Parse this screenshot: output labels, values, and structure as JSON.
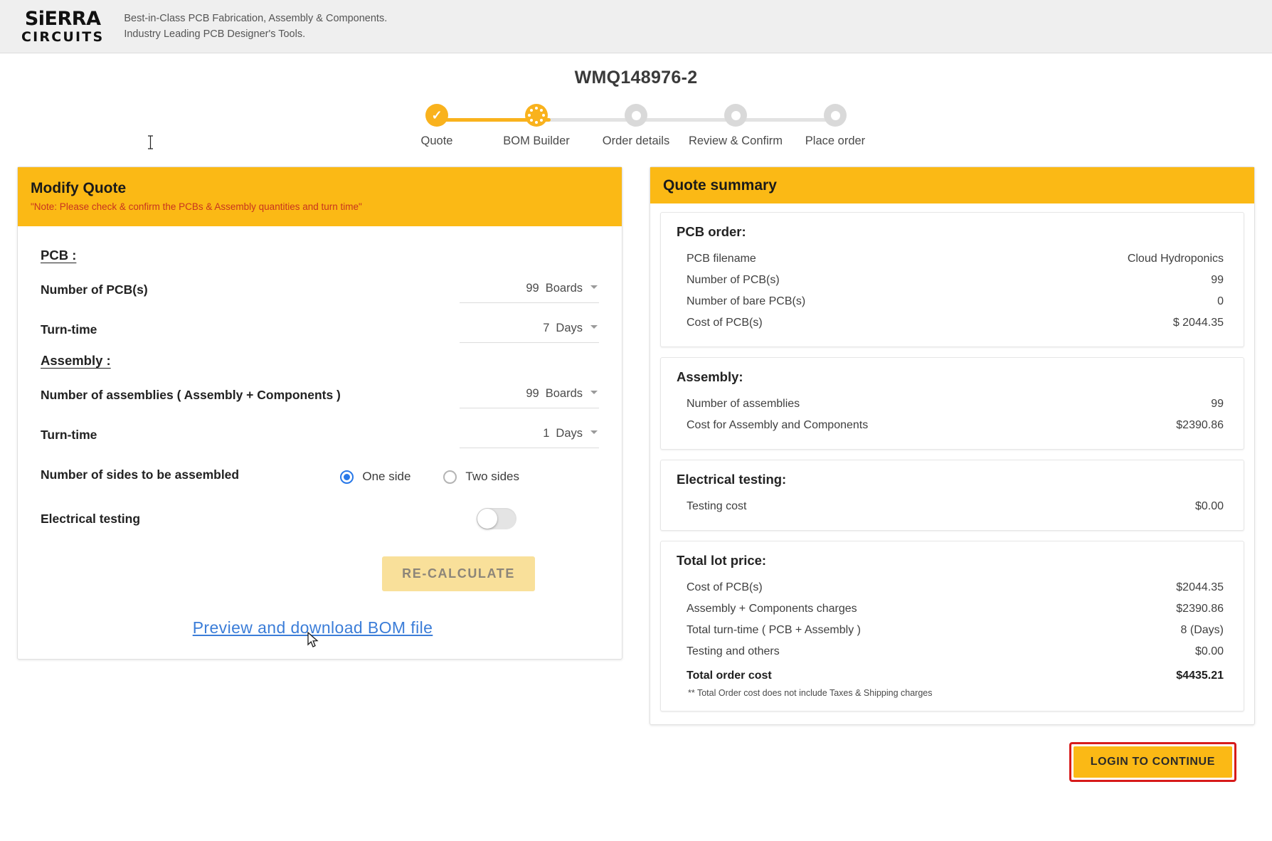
{
  "header": {
    "logo_top": "SiERRA",
    "logo_bottom": "CIRCUITS",
    "tagline_line1": "Best-in-Class PCB Fabrication, Assembly & Components.",
    "tagline_line2": "Industry Leading PCB Designer's Tools."
  },
  "quote_id": "WMQ148976-2",
  "stepper": {
    "steps": [
      {
        "label": "Quote",
        "state": "done"
      },
      {
        "label": "BOM Builder",
        "state": "active"
      },
      {
        "label": "Order details",
        "state": "pending"
      },
      {
        "label": "Review & Confirm",
        "state": "pending"
      },
      {
        "label": "Place order",
        "state": "pending"
      }
    ]
  },
  "modify_quote": {
    "title": "Modify Quote",
    "note": "\"Note: Please check & confirm the PCBs & Assembly quantities and turn time\"",
    "pcb_section_label": "PCB :",
    "assembly_section_label": "Assembly :",
    "rows": {
      "number_of_pcbs": {
        "label": "Number of PCB(s)",
        "value": "99",
        "unit": "Boards"
      },
      "pcb_turn_time": {
        "label": "Turn-time",
        "value": "7",
        "unit": "Days"
      },
      "number_of_assemblies": {
        "label": "Number of assemblies ( Assembly + Components )",
        "value": "99",
        "unit": "Boards"
      },
      "assembly_turn_time": {
        "label": "Turn-time",
        "value": "1",
        "unit": "Days"
      },
      "sides": {
        "label": "Number of sides to be assembled",
        "option_one": "One side",
        "option_two": "Two sides",
        "selected": "One side"
      },
      "electrical_testing": {
        "label": "Electrical testing",
        "enabled": false
      }
    },
    "recalculate_label": "RE-CALCULATE",
    "bom_link_label": "Preview and download BOM file"
  },
  "quote_summary": {
    "title": "Quote summary",
    "cards": [
      {
        "heading": "PCB order:",
        "rows": [
          {
            "label": "PCB filename",
            "value": "Cloud Hydroponics"
          },
          {
            "label": "Number of PCB(s)",
            "value": "99"
          },
          {
            "label": "Number of bare PCB(s)",
            "value": "0"
          },
          {
            "label": "Cost of PCB(s)",
            "value": "$ 2044.35"
          }
        ]
      },
      {
        "heading": "Assembly:",
        "rows": [
          {
            "label": "Number of assemblies",
            "value": "99"
          },
          {
            "label": "Cost for Assembly and Components",
            "value": "$2390.86"
          }
        ]
      },
      {
        "heading": "Electrical testing:",
        "rows": [
          {
            "label": "Testing cost",
            "value": "$0.00"
          }
        ]
      },
      {
        "heading": "Total lot price:",
        "rows": [
          {
            "label": "Cost of PCB(s)",
            "value": "$2044.35"
          },
          {
            "label": "Assembly + Components charges",
            "value": "$2390.86"
          },
          {
            "label": "Total turn-time ( PCB + Assembly )",
            "value": "8 (Days)"
          },
          {
            "label": "Testing and others",
            "value": "$0.00"
          }
        ],
        "total_label": "Total order cost",
        "total_value": "$4435.21",
        "disclaimer": "** Total Order cost does not include Taxes & Shipping charges"
      }
    ]
  },
  "footer": {
    "login_label": "LOGIN TO CONTINUE"
  },
  "colors": {
    "brand_yellow": "#fbb915",
    "link_blue": "#3b7dd8",
    "note_red": "#c8341f",
    "highlight_red": "#d71b1b",
    "radio_blue": "#2878e8"
  }
}
